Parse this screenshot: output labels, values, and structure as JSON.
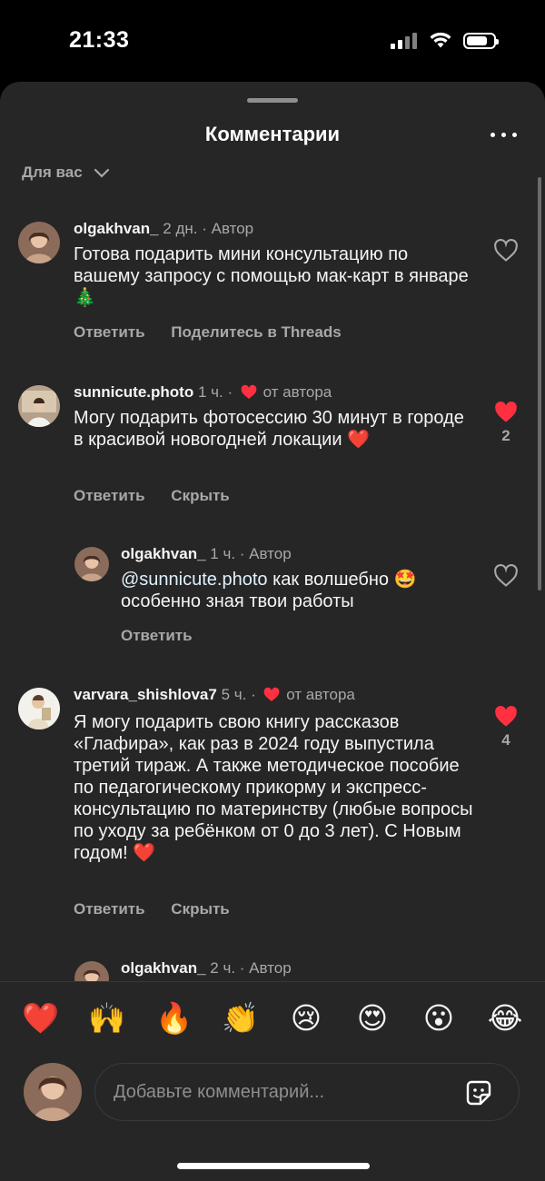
{
  "status": {
    "time": "21:33"
  },
  "header": {
    "title": "Комментарии"
  },
  "filter": {
    "label": "Для вас"
  },
  "comments": [
    {
      "user": "olgakhvan_",
      "time": "2 дн.",
      "tag": "Автор",
      "text": "Готова подарить мини консультацию по вашему запросу с помощью мак-карт в январе 🎄",
      "actions": [
        "Ответить",
        "Поделитесь в Threads"
      ],
      "likes": ""
    },
    {
      "user": "sunnicute.photo",
      "time": "1 ч.",
      "tag": "от автора",
      "text": "Могу подарить фотосессию 30 минут в городе в красивой новогодней локации ❤️",
      "actions": [
        "Ответить",
        "Скрыть"
      ],
      "likes": "2"
    },
    {
      "user": "olgakhvan_",
      "time": "1 ч.",
      "tag": "Автор",
      "mention": "@sunnicute.photo",
      "text": " как волшебно 🤩 особенно зная твои работы",
      "actions": [
        "Ответить"
      ],
      "likes": ""
    },
    {
      "user": "varvara_shishlova7",
      "time": "5 ч.",
      "tag": "от автора",
      "text": "Я могу подарить свою книгу рассказов «Глафира», как раз в 2024 году выпустила третий тираж. А также методическое пособие по педагогическому прикорму и экспресс-консультацию по материнству (любые вопросы по уходу за ребёнком от 0 до 3 лет). С Новым годом! ❤️",
      "actions": [
        "Ответить",
        "Скрыть"
      ],
      "likes": "4"
    },
    {
      "user": "olgakhvan_",
      "time": "2 ч.",
      "tag": "Автор"
    }
  ],
  "emoji_bar": [
    "❤️",
    "🙌",
    "🔥",
    "👏",
    "😢",
    "😍",
    "😮",
    "😂"
  ],
  "composer": {
    "placeholder": "Добавьте комментарий..."
  },
  "colors": {
    "like_red": "#ff3040",
    "sheet_bg": "#262626"
  }
}
